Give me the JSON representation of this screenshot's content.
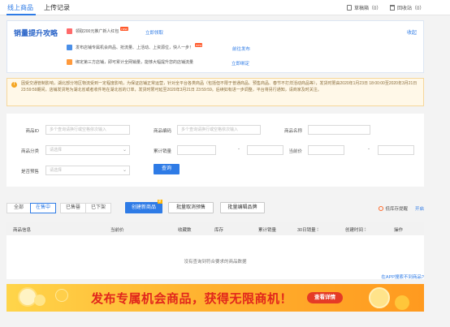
{
  "top_tabs": [
    {
      "label": "线上商品"
    },
    {
      "label": "上传记录"
    }
  ],
  "top_right": {
    "drafts": "草稿箱（0）",
    "recycle": "回收站（0）"
  },
  "promo": {
    "title": "销量提升攻略",
    "collapse": "收起",
    "rows": [
      {
        "text": "领取200元推广新人红包",
        "badge": "new",
        "link": "立即领取",
        "icon_color": "#ff6a6a"
      },
      {
        "text": "发布店铺专属机会商品、抢流量、上活动、上资源位，快人一步！",
        "badge": "new",
        "link": "前往发布",
        "icon_color": "#4a8fe8"
      },
      {
        "text": "绑定第三方店铺，即可累计全网销量，能够大幅提升您的店铺流量",
        "badge": "",
        "link": "立即绑定",
        "icon_color": "#ff9a3c"
      }
    ]
  },
  "notice": {
    "icon": "warning-icon",
    "text": "因受交通管制影响，湖北部分地区物流受到一定程度影响，为保证店铺正常运营，针对全平台各类商品（包括但不限于普通商品、预售商品、春节不打烊活动商品等），发货时限由2020年1月23日 18:00:00至2020年3月21日 23:59:59期间，店铺发货地为湖北省或者收件地在湖北省的订单，发货时限可延至2020年3月21日 23:59:59。后续如有进一步调整，平台将另行通知，请商家及时关注。"
  },
  "filters": {
    "product_id_label": "商品ID",
    "product_id_placeholder": "多个查询请换行或空格依次输入",
    "product_code_label": "商品编码",
    "product_code_placeholder": "多个查询请换行或空格依次输入",
    "product_name_label": "商品名称",
    "category_label": "商品分类",
    "category_placeholder": "请选择",
    "sales_label": "累计销量",
    "price_label": "当前价",
    "presale_label": "是否预售",
    "presale_placeholder": "请选择",
    "query_button": "查询",
    "range_dash": "-"
  },
  "status_tabs": [
    {
      "label": "全部"
    },
    {
      "label": "在售中"
    },
    {
      "label": "已售罄"
    },
    {
      "label": "已下架"
    }
  ],
  "actions": {
    "create": "创建新商品",
    "create_badge": "新",
    "cancel_presale": "批量取消预售",
    "bulk_edit_brand": "批量编辑品牌",
    "low_stock": "低库存提醒",
    "toggle": "开启"
  },
  "table": {
    "columns": [
      "商品信息",
      "当前价",
      "收藏数",
      "库存",
      "累计销量",
      "30日销量",
      "创建时间",
      "操作"
    ],
    "empty": "没有查询到符合要求的商品数据",
    "app_link": "在APP搜索不到商品?"
  },
  "banner": {
    "text": "发布专属机会商品，获得无限商机！",
    "button": "查看详情"
  },
  "colors": {
    "accent": "#2e7be6",
    "banner_text": "#e1261c",
    "banner_button": "#e53a26",
    "notice_bg": "#fff8e8"
  }
}
